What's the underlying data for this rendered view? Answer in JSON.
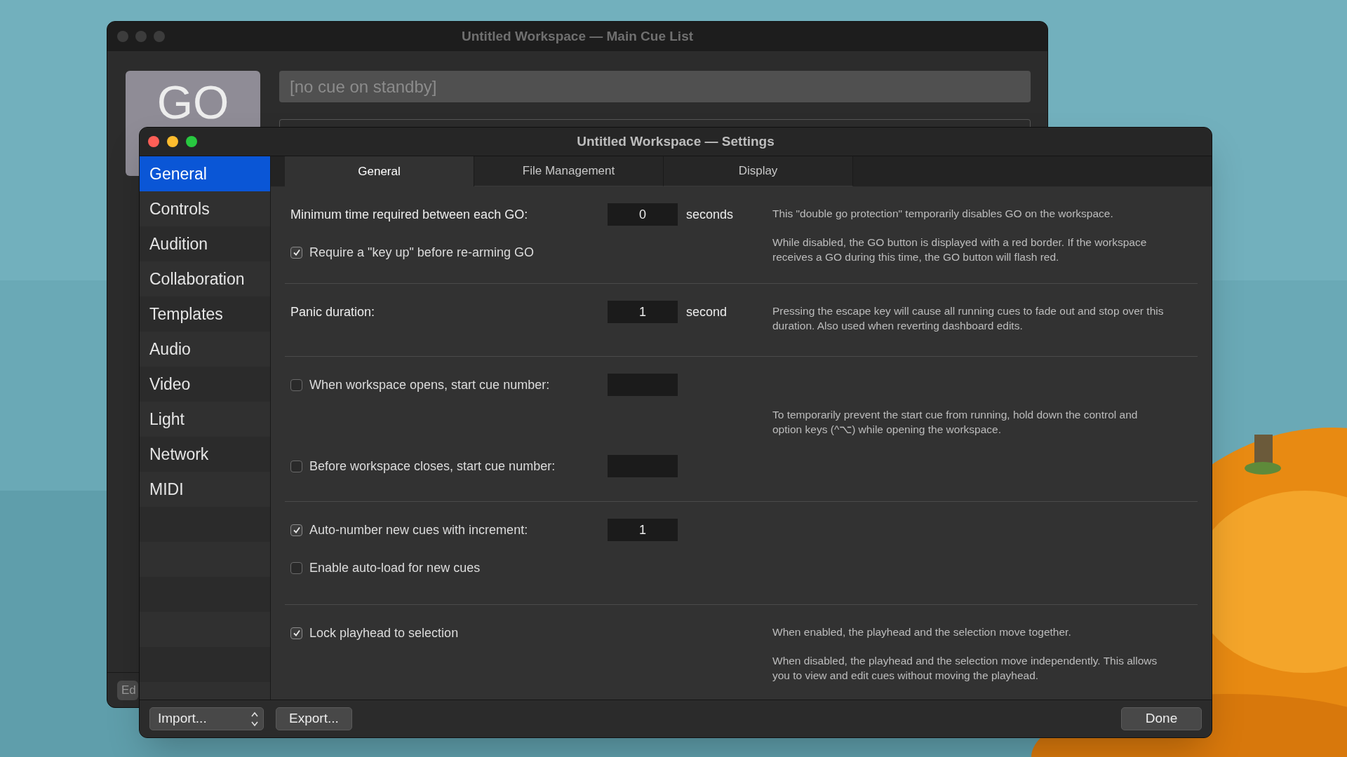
{
  "back_window": {
    "title": "Untitled Workspace — Main Cue List",
    "go_button": "GO",
    "standby": "[no cue on standby]",
    "edit_button": "Ed"
  },
  "window": {
    "title": "Untitled Workspace — Settings"
  },
  "sidebar": {
    "items": [
      {
        "label": "General",
        "selected": true
      },
      {
        "label": "Controls",
        "selected": false
      },
      {
        "label": "Audition",
        "selected": false
      },
      {
        "label": "Collaboration",
        "selected": false
      },
      {
        "label": "Templates",
        "selected": false
      },
      {
        "label": "Audio",
        "selected": false
      },
      {
        "label": "Video",
        "selected": false
      },
      {
        "label": "Light",
        "selected": false
      },
      {
        "label": "Network",
        "selected": false
      },
      {
        "label": "MIDI",
        "selected": false
      }
    ]
  },
  "tabs": [
    {
      "label": "General",
      "selected": true
    },
    {
      "label": "File Management",
      "selected": false
    },
    {
      "label": "Display",
      "selected": false
    }
  ],
  "sections": [
    {
      "rows": [
        {
          "kind": "field",
          "label": "Minimum time required between each GO:",
          "value": "0",
          "unit": "seconds"
        },
        {
          "kind": "checkbox",
          "label": "Require a \"key up\" before re-arming GO",
          "checked": true
        }
      ],
      "notes": [
        "This \"double go protection\" temporarily disables GO on the workspace.",
        "While disabled, the GO button is displayed with a red border. If the workspace receives a GO during this time, the GO button will flash red."
      ]
    },
    {
      "rows": [
        {
          "kind": "field",
          "label": "Panic duration:",
          "value": "1",
          "unit": "second"
        }
      ],
      "notes": [
        "Pressing the escape key will cause all running cues to fade out and stop over this duration. Also used when reverting dashboard edits."
      ]
    },
    {
      "rows": [
        {
          "kind": "checkbox_field",
          "label": "When workspace opens, start cue number:",
          "checked": false
        },
        {
          "kind": "checkbox_field",
          "label": "Before workspace closes, start cue number:",
          "checked": false
        }
      ],
      "notes": [
        "To temporarily prevent the start cue from running, hold down the control and option keys (^⌥) while opening the workspace."
      ]
    },
    {
      "rows": [
        {
          "kind": "checkbox_field",
          "label": "Auto-number new cues with increment:",
          "checked": true,
          "value": "1"
        },
        {
          "kind": "checkbox",
          "label": "Enable auto-load for new cues",
          "checked": false
        }
      ]
    },
    {
      "rows": [
        {
          "kind": "checkbox",
          "label": "Lock playhead to selection",
          "checked": true
        }
      ],
      "notes": [
        "When enabled, the playhead and the selection move together.",
        "When disabled, the playhead and the selection move independently. This allows you to view and edit cues without moving the playhead."
      ]
    }
  ],
  "footer": {
    "import": "Import...",
    "export": "Export...",
    "done": "Done"
  }
}
